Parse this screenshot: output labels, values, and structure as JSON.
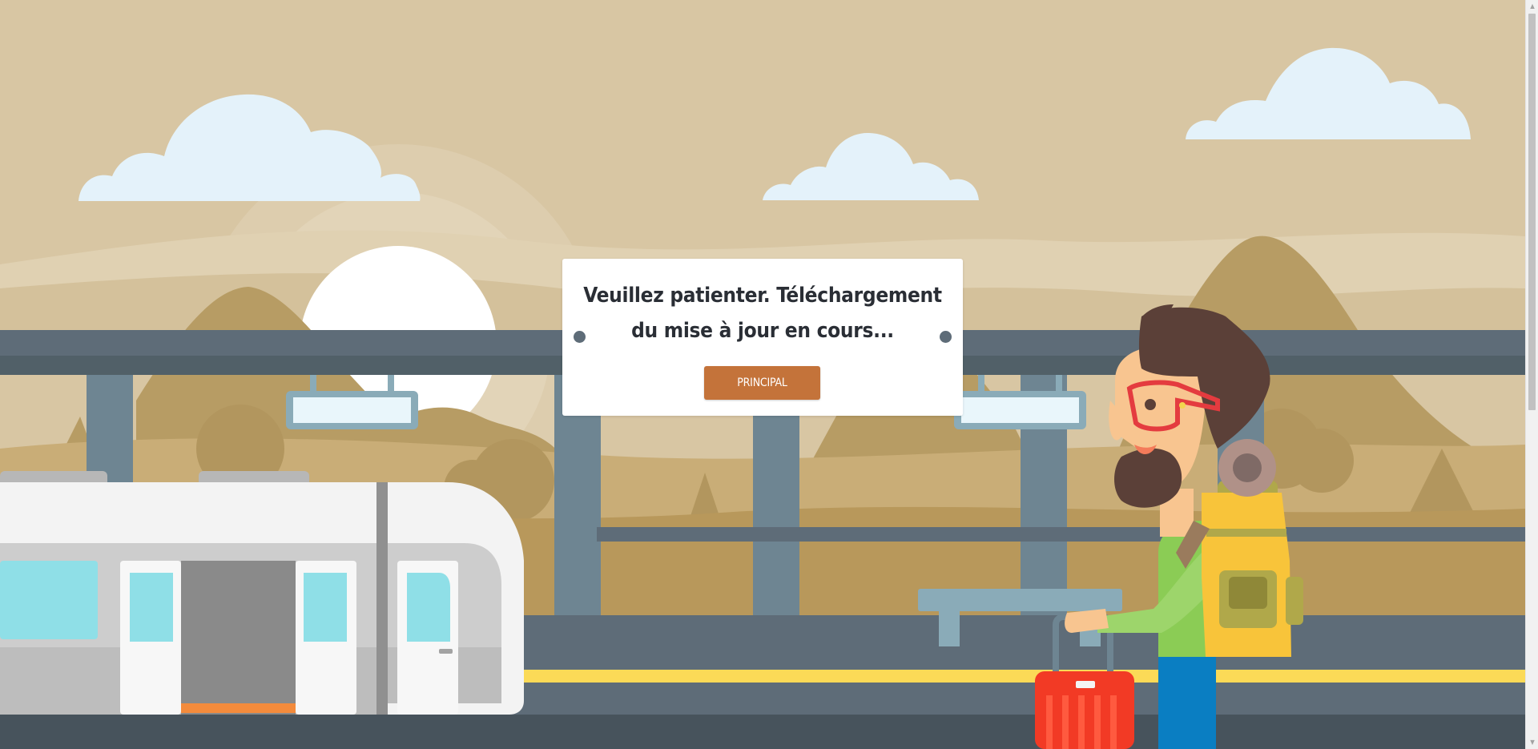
{
  "notice": {
    "message": "Veuillez patienter. Téléchargement du mise à jour en cours...",
    "button_label": "PRINCIPAL"
  },
  "colors": {
    "sky": "#d8c6a3",
    "cloud": "#e4f2fa",
    "mountain": "#b79c64",
    "roof": "#5e6c78",
    "pillar": "#6e8592",
    "platform_stripe": "#fbda57",
    "button": "#c4733a"
  },
  "icons": {
    "scroll_up": "triangle-up",
    "scroll_down": "triangle-down"
  }
}
